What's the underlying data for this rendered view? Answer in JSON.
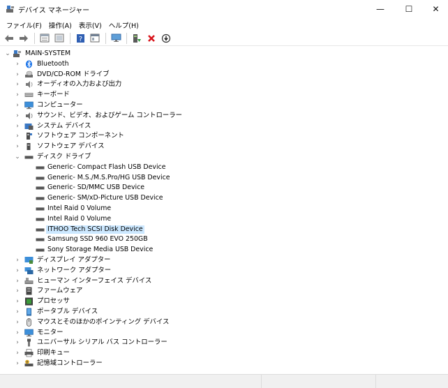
{
  "window": {
    "title": "デバイス マネージャー",
    "minimize": "—",
    "maximize": "☐",
    "close": "✕"
  },
  "menu": [
    "ファイル(F)",
    "操作(A)",
    "表示(V)",
    "ヘルプ(H)"
  ],
  "toolbar": {
    "buttons": [
      "back-icon",
      "forward-icon",
      "properties-icon",
      "show-hide-icon",
      "help-icon",
      "view-icon",
      "monitor-icon",
      "update-driver-icon",
      "uninstall-icon",
      "scan-hardware-icon"
    ]
  },
  "tree": {
    "root": "MAIN-SYSTEM",
    "categories": [
      {
        "label": "Bluetooth",
        "icon": "bluetooth-icon",
        "expanded": false
      },
      {
        "label": "DVD/CD-ROM ドライブ",
        "icon": "dvd-drive-icon",
        "expanded": false
      },
      {
        "label": "オーディオの入力および出力",
        "icon": "speaker-icon",
        "expanded": false
      },
      {
        "label": "キーボード",
        "icon": "keyboard-icon",
        "expanded": false
      },
      {
        "label": "コンピューター",
        "icon": "computer-icon",
        "expanded": false
      },
      {
        "label": "サウンド、ビデオ、およびゲーム コントローラー",
        "icon": "sound-icon",
        "expanded": false
      },
      {
        "label": "システム デバイス",
        "icon": "system-device-icon",
        "expanded": false
      },
      {
        "label": "ソフトウェア コンポーネント",
        "icon": "software-component-icon",
        "expanded": false
      },
      {
        "label": "ソフトウェア デバイス",
        "icon": "software-device-icon",
        "expanded": false
      },
      {
        "label": "ディスク ドライブ",
        "icon": "disk-drive-icon",
        "expanded": true
      },
      {
        "label": "ディスプレイ アダプター",
        "icon": "display-adapter-icon",
        "expanded": false
      },
      {
        "label": "ネットワーク アダプター",
        "icon": "network-adapter-icon",
        "expanded": false
      },
      {
        "label": "ヒューマン インターフェイス デバイス",
        "icon": "hid-icon",
        "expanded": false
      },
      {
        "label": "ファームウェア",
        "icon": "firmware-icon",
        "expanded": false
      },
      {
        "label": "プロセッサ",
        "icon": "processor-icon",
        "expanded": false
      },
      {
        "label": "ポータブル デバイス",
        "icon": "portable-device-icon",
        "expanded": false
      },
      {
        "label": "マウスとそのほかのポインティング デバイス",
        "icon": "mouse-icon",
        "expanded": false
      },
      {
        "label": "モニター",
        "icon": "monitor-icon",
        "expanded": false
      },
      {
        "label": "ユニバーサル シリアル バス コントローラー",
        "icon": "usb-icon",
        "expanded": false
      },
      {
        "label": "印刷キュー",
        "icon": "printer-icon",
        "expanded": false
      },
      {
        "label": "記憶域コントローラー",
        "icon": "storage-controller-icon",
        "expanded": false
      }
    ],
    "disk_drives": [
      {
        "label": "Generic- Compact Flash USB Device",
        "selected": false
      },
      {
        "label": "Generic- M.S./M.S.Pro/HG USB Device",
        "selected": false
      },
      {
        "label": "Generic- SD/MMC USB Device",
        "selected": false
      },
      {
        "label": "Generic- SM/xD-Picture USB Device",
        "selected": false
      },
      {
        "label": "Intel Raid 0 Volume",
        "selected": false
      },
      {
        "label": "Intel Raid 0 Volume",
        "selected": false
      },
      {
        "label": "ITHOO Tech SCSI Disk Device",
        "selected": true
      },
      {
        "label": "Samsung SSD 960 EVO 250GB",
        "selected": false
      },
      {
        "label": "Sony Storage Media USB Device",
        "selected": false
      }
    ]
  },
  "colors": {
    "selection": "#cce8ff",
    "statusbar": "#f0f0f0"
  }
}
